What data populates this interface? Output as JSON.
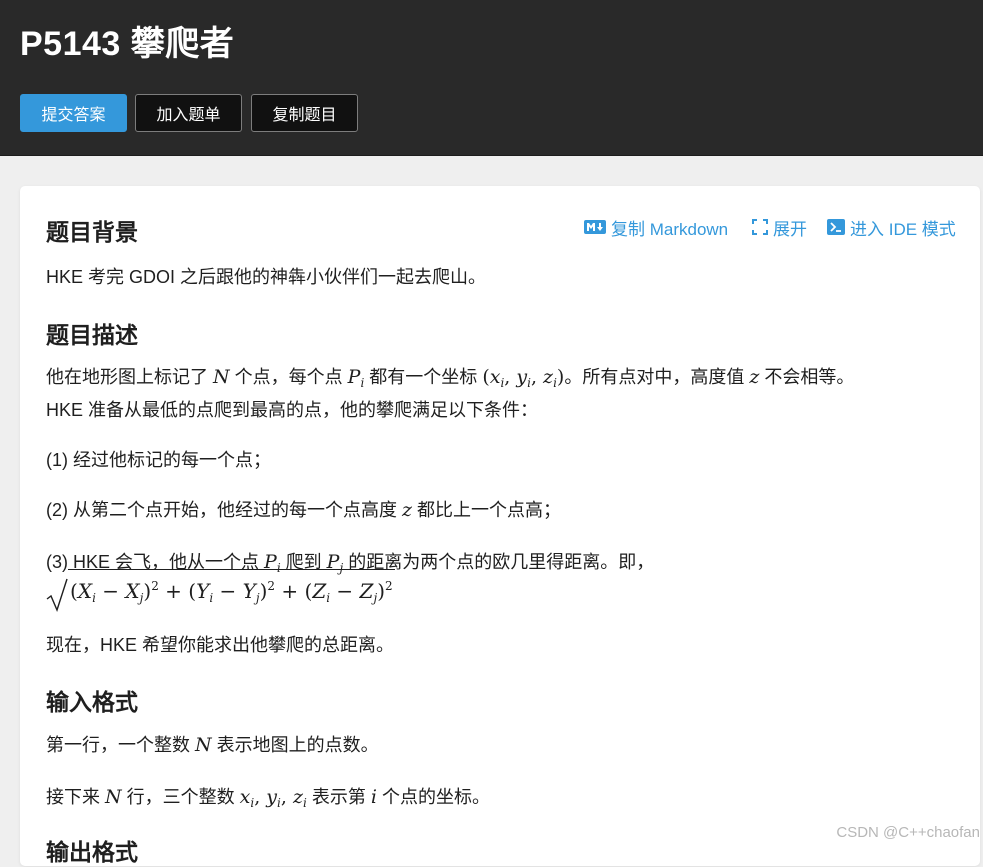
{
  "header": {
    "title": "P5143 攀爬者",
    "buttons": {
      "submit": "提交答案",
      "add_to_list": "加入题单",
      "copy_problem": "复制题目"
    }
  },
  "toolbar": {
    "copy_markdown": "复制 Markdown",
    "expand": "展开",
    "enter_ide": "进入 IDE 模式"
  },
  "sections": {
    "background": {
      "title": "题目背景",
      "text": "HKE 考完 GDOI 之后跟他的神犇小伙伴们一起去爬山。"
    },
    "description": {
      "title": "题目描述",
      "line1_a": "他在地形图上标记了 ",
      "line1_b": " 个点，每个点 ",
      "line1_c": " 都有一个坐标 ",
      "line1_d": "。所有点对中，高度值 ",
      "line1_e": " 不会相等。",
      "line2": "HKE 准备从最低的点爬到最高的点，他的攀爬满足以下条件：",
      "cond1": "(1) 经过他标记的每一个点；",
      "cond2_a": "(2) 从第二个点开始，他经过的每一个点高度 ",
      "cond2_b": " 都比上一个点高；",
      "cond3_a": "(3) HKE 会飞，他从一个点 ",
      "cond3_b": " 爬到 ",
      "cond3_c": " 的距离为两个点的欧几里得距离。即，",
      "ending": "现在，HKE 希望你能求出他攀爬的总距离。"
    },
    "input": {
      "title": "输入格式",
      "line1_a": "第一行，一个整数 ",
      "line1_b": " 表示地图上的点数。",
      "line2_a": "接下来 ",
      "line2_b": " 行，三个整数 ",
      "line2_c": " 表示第 ",
      "line2_d": " 个点的坐标。"
    },
    "output": {
      "title": "输出格式"
    }
  },
  "watermark": "CSDN @C++chaofan",
  "colors": {
    "header_bg": "#292929",
    "accent": "#3498db",
    "page_bg": "#efefef"
  },
  "icons": {
    "copy_markdown": "markdown-icon",
    "expand": "expand-icon",
    "ide": "terminal-icon"
  }
}
